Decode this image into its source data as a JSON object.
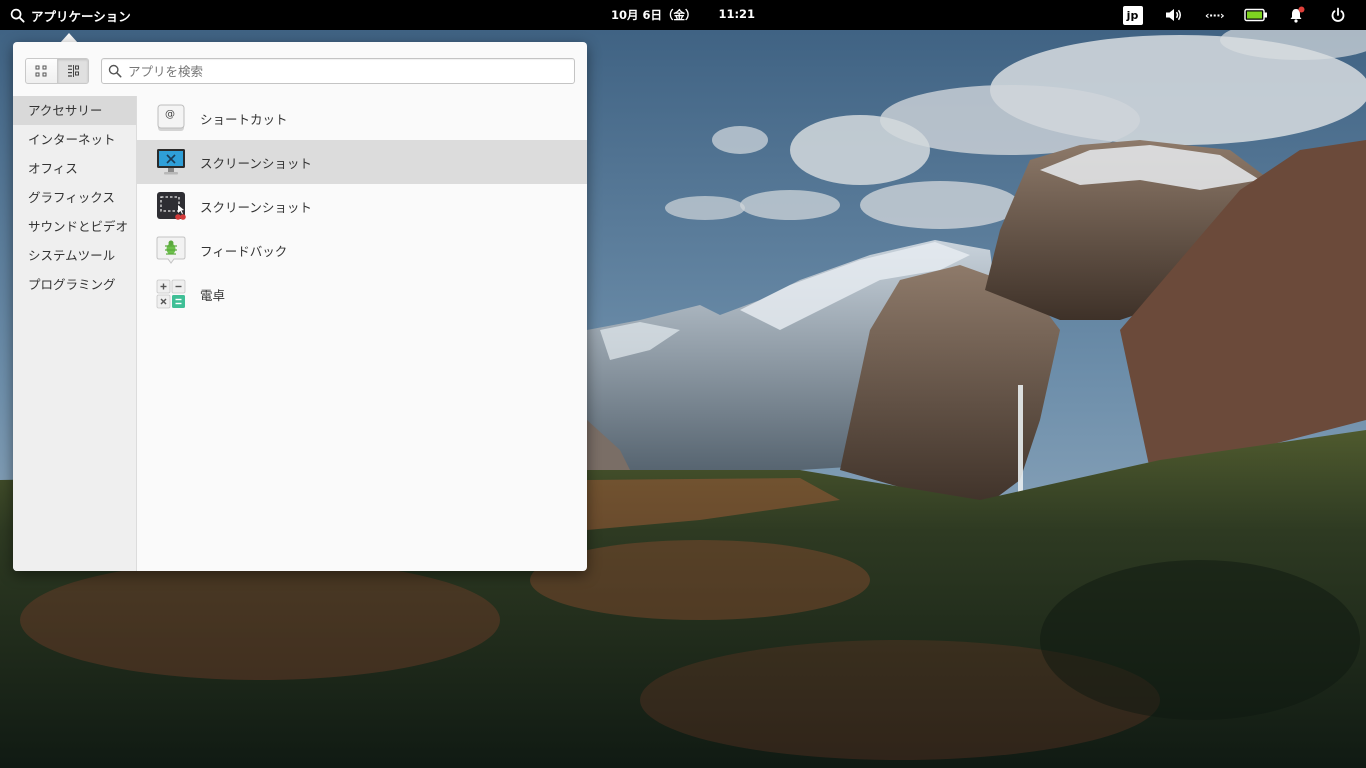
{
  "panel": {
    "applications_label": "アプリケーション",
    "date": "10月 6日（金）",
    "time": "11:21",
    "keyboard_layout": "jp",
    "network_text": "‹···›"
  },
  "menu": {
    "search_placeholder": "アプリを検索",
    "categories": [
      {
        "label": "アクセサリー",
        "selected": true
      },
      {
        "label": "インターネット"
      },
      {
        "label": "オフィス"
      },
      {
        "label": "グラフィックス"
      },
      {
        "label": "サウンドとビデオ"
      },
      {
        "label": "システムツール"
      },
      {
        "label": "プログラミング"
      }
    ],
    "apps": [
      {
        "label": "ショートカット",
        "icon": "keyboard-shortcut-icon"
      },
      {
        "label": "スクリーンショット",
        "icon": "screenshot-monitor-icon",
        "highlighted": true
      },
      {
        "label": "スクリーンショット",
        "icon": "screenshot-selection-icon"
      },
      {
        "label": "フィードバック",
        "icon": "feedback-bug-icon"
      },
      {
        "label": "電卓",
        "icon": "calculator-icon"
      }
    ]
  },
  "colors": {
    "panel_bg": "#000000",
    "menu_bg": "#fafafa",
    "sidebar_bg": "#efefef",
    "selection_bg": "#d9d9d9",
    "battery_green": "#7ed321",
    "notification_red": "#e0403a"
  }
}
